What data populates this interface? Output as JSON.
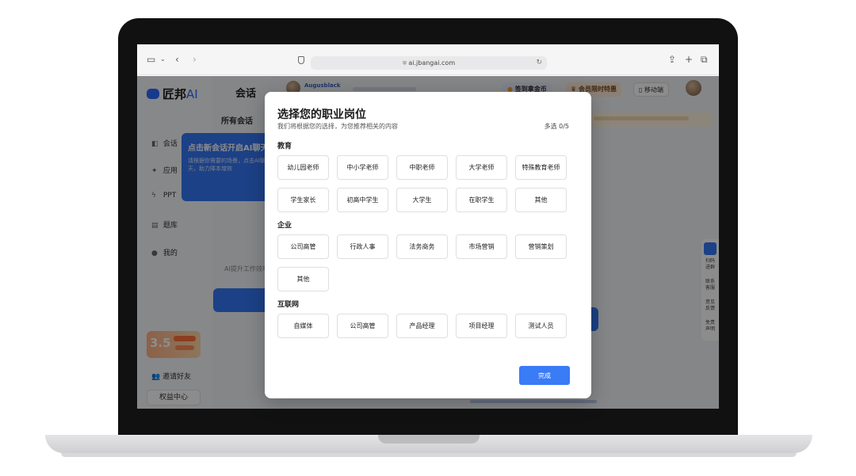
{
  "browser": {
    "url": "ai.jbangai.com"
  },
  "app": {
    "brand": "匠邦",
    "brand_suffix": "AI",
    "pane_title": "会话",
    "pane_subtitle": "所有会话",
    "nav": [
      {
        "label": "会话",
        "icon": "chat-icon"
      },
      {
        "label": "应用",
        "icon": "sparkle-icon"
      },
      {
        "label": "PPT",
        "icon": "bolt-icon"
      },
      {
        "label": "题库",
        "icon": "book-icon"
      },
      {
        "label": "我的",
        "icon": "user-icon"
      }
    ],
    "hint_title": "点击新会话开启AI聊天",
    "hint_desc": "请根据你需要的场景，点击AI聊天，助力降本增效",
    "pane_tagline": "AI提升工作效率",
    "promo_big": "3.5",
    "invite_label": "邀请好友",
    "rights_label": "权益中心",
    "username": "Augusblack",
    "checkin_label": "签到拿金币",
    "vip_label": "会员限时特惠",
    "mobile_label": "移动端",
    "rail_items": [
      "扫码进群",
      "联系客服",
      "意见反馈",
      "免责声明"
    ]
  },
  "modal": {
    "title": "选择您的职业岗位",
    "subtitle": "我们将根据您的选择，为您推荐相关的内容",
    "count_label": "多选 0/5",
    "categories": [
      {
        "name": "教育",
        "options": [
          "幼儿园老师",
          "中小学老师",
          "中职老师",
          "大学老师",
          "特殊教育老师",
          "学生家长",
          "初高中学生",
          "大学生",
          "在职学生",
          "其他"
        ]
      },
      {
        "name": "企业",
        "options": [
          "公司高管",
          "行政人事",
          "法务商务",
          "市场营销",
          "营销策划",
          "其他"
        ]
      },
      {
        "name": "互联网",
        "options": [
          "自媒体",
          "公司高管",
          "产品经理",
          "项目经理",
          "测试人员"
        ]
      }
    ],
    "done_label": "完成"
  },
  "colors": {
    "accent": "#3A7BF6",
    "scrim": "rgba(0,0,0,0.45)"
  }
}
